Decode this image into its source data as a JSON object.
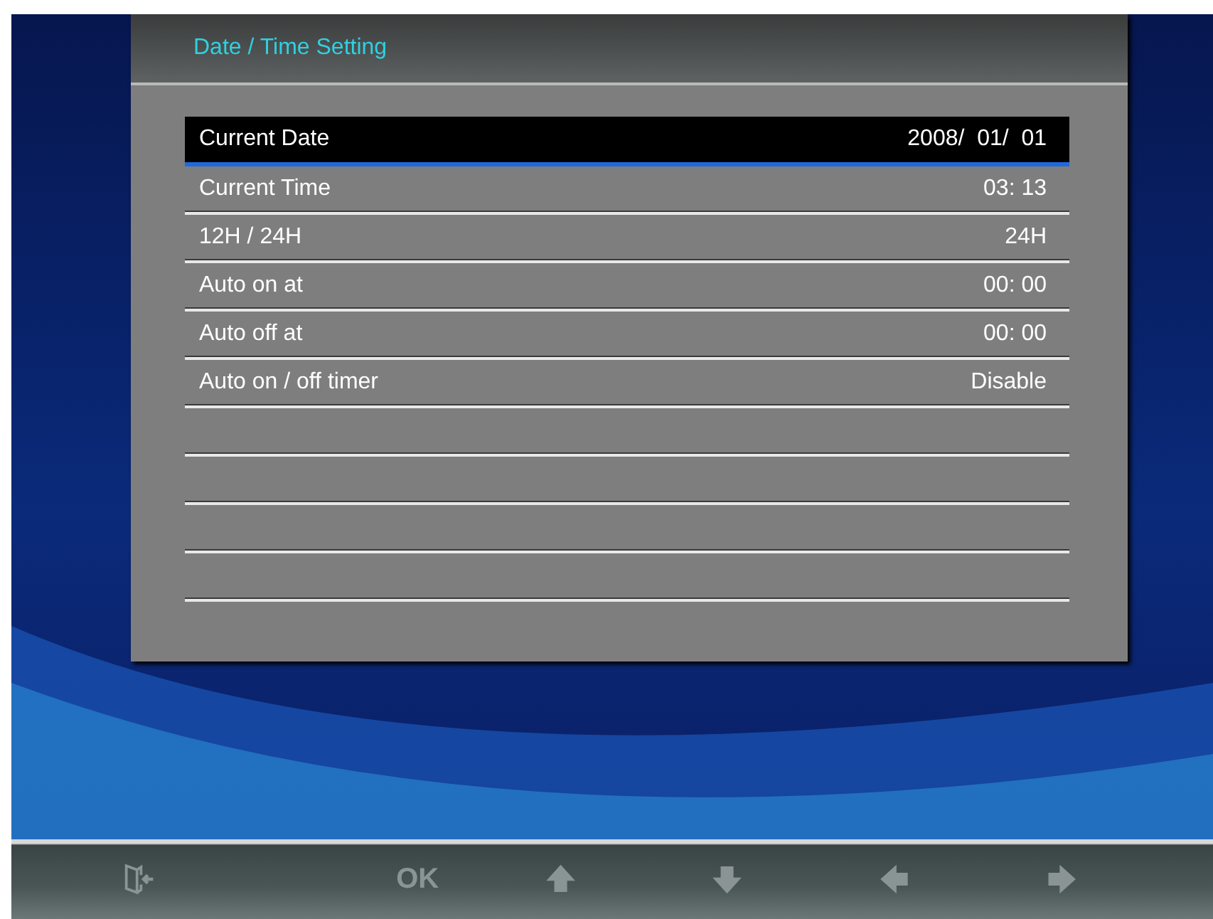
{
  "panel": {
    "title": "Date / Time Setting"
  },
  "rows": [
    {
      "label": "Current Date",
      "value": "2008/  01/  01",
      "selected": true
    },
    {
      "label": "Current Time",
      "value": "03: 13",
      "selected": false
    },
    {
      "label": "12H / 24H",
      "value": "24H",
      "selected": false
    },
    {
      "label": "Auto on at",
      "value": "00: 00",
      "selected": false
    },
    {
      "label": "Auto off at",
      "value": "00: 00",
      "selected": false
    },
    {
      "label": "Auto on / off timer",
      "value": "Disable",
      "selected": false
    }
  ],
  "bottom_bar": [
    {
      "kind": "exit"
    },
    {
      "kind": "text",
      "label": "OK"
    },
    {
      "kind": "up"
    },
    {
      "kind": "down"
    },
    {
      "kind": "left"
    },
    {
      "kind": "right"
    }
  ]
}
